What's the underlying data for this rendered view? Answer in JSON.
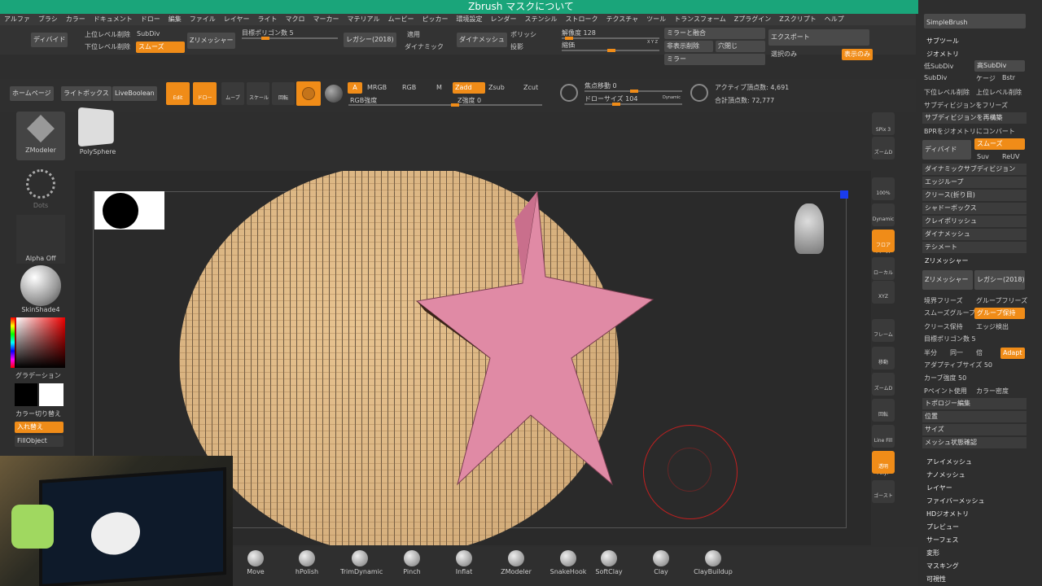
{
  "title": "Zbrush マスクについて",
  "menu": [
    "アルファ",
    "ブラシ",
    "カラー",
    "ドキュメント",
    "ドロー",
    "編集",
    "ファイル",
    "レイヤー",
    "ライト",
    "マクロ",
    "マーカー",
    "マテリアル",
    "ムービー",
    "ピッカー",
    "環境設定",
    "レンダー",
    "ステンシル",
    "ストローク",
    "テクスチャ",
    "ツール",
    "トランスフォーム",
    "Zプラグイン",
    "Zスクリプト",
    "ヘルプ"
  ],
  "top": {
    "divide": "ディバイド",
    "lower_del": "上位レベル削除",
    "upper_del": "下位レベル削除",
    "subdiv": "SubDiv",
    "smooth": "スムーズ",
    "zremesher": "Zリメッシャー",
    "target_poly": "目標ポリゴン数 5",
    "legacy": "レガシー(2018)",
    "apply": "適用",
    "dynamic": "ダイナミック",
    "dynamesh": "ダイナメッシュ",
    "polish": "ポリッシ",
    "project": "投影",
    "resolution": "解像度 128",
    "blur": "縮価",
    "xyz": "X Y Z",
    "mirror_weld": "ミラーと融合",
    "del_hidden": "非表示削除",
    "close_holes": "穴閉じ",
    "mirror": "ミラー",
    "export": "エクスポート",
    "selected_only": "選択のみ",
    "show_only": "表示のみ"
  },
  "toolbar": {
    "home": "ホームページ",
    "lightbox": "ライトボックス",
    "liveboolean": "LiveBoolean",
    "edit": "Edit",
    "draw": "ドロー",
    "move": "ムーブ",
    "scale": "スケール",
    "rotate": "回転",
    "a": "A",
    "mrgb": "MRGB",
    "rgb": "RGB",
    "m": "M",
    "zadd": "Zadd",
    "zsub": "Zsub",
    "zcut": "Zcut",
    "rgb_strength": "RGB強度",
    "z_strength": "Z強度 0",
    "focal": "焦点移動 0",
    "draw_size": "ドローサイズ 104",
    "dynamic": "Dynamic",
    "active_points": "アクティブ頂点数: 4,691",
    "total_points": "合計頂点数: 72,777"
  },
  "left": {
    "zmodeler": "ZModeler",
    "polysphere": "PolySphere",
    "dots": "Dots",
    "alpha_off": "Alpha Off",
    "skinshade": "SkinShade4",
    "gradient": "グラデーション",
    "switch_color": "カラー切り替え",
    "swap": "入れ替え",
    "fill_object": "FillObject"
  },
  "right_icons": [
    "SPix 3",
    "ズームD",
    "100%",
    "Dynamic パース",
    "フロア",
    "ローカル",
    "XYZ",
    "フレーム",
    "移動",
    "ズームD",
    "回転",
    "Line Fill PolyF",
    "透明",
    "ゴースト"
  ],
  "right_panel": {
    "simplebrush": "SimpleBrush",
    "subtool": "サブツール",
    "geometry": "ジオメトリ",
    "lower_subdiv": "低SubDiv",
    "higher_subdiv": "高SubDiv",
    "subdiv": "SubDiv",
    "cage": "ケージ",
    "bstr": "Bstr",
    "del_lower": "下位レベル削除",
    "del_higher": "上位レベル削除",
    "freeze": "サブディビジョンをフリーズ",
    "reconstruct": "サブディビジョンを再構築",
    "bpr": "BPRをジオメトリにコンバート",
    "divide": "ディバイド",
    "smooth": "スムーズ",
    "suv": "Suv",
    "reuv": "ReUV",
    "items": [
      "ダイナミックサブディビジョン",
      "エッジループ",
      "クリース(折り目)",
      "シャドーボックス",
      "クレイポリッシュ",
      "ダイナメッシュ",
      "テシメート"
    ],
    "zremesher": "Zリメッシャー",
    "zremesher_btn": "Zリメッシャー",
    "legacy": "レガシー(2018)",
    "freeze_border": "境界フリーズ",
    "freeze_groups": "グループフリーズ",
    "smooth_groups": "スムーズグループ",
    "keep_groups": "グループ保持",
    "keep_creases": "クリース保持",
    "detect_edges": "エッジ検出",
    "target": "目標ポリゴン数 5",
    "half": "半分",
    "same": "同一",
    "double": "倍",
    "adapt": "Adapt",
    "adaptive": "アダプティブサイズ 50",
    "curve": "カーブ強度 50",
    "paint": "Pペイント使用",
    "color_intensity": "カラー密度",
    "topology": "トポロジー編集",
    "position": "位置",
    "size": "サイズ",
    "mesh_integrity": "メッシュ状態確認",
    "lower": [
      "アレイメッシュ",
      "ナノメッシュ",
      "レイヤー",
      "ファイバーメッシュ",
      "HDジオメトリ",
      "プレビュー",
      "サーフェス",
      "変形",
      "マスキング",
      "可視性"
    ]
  },
  "brushes": [
    "Move",
    "hPolish",
    "TrimDynamic",
    "Pinch",
    "Inflat",
    "ZModeler",
    "SnakeHook",
    "SoftClay",
    "Clay",
    "ClayBuildup"
  ],
  "colors": {
    "accent": "#f08c18",
    "title": "#1aa57a",
    "sphere": "#e6c08c",
    "star": "#e08aa5"
  }
}
